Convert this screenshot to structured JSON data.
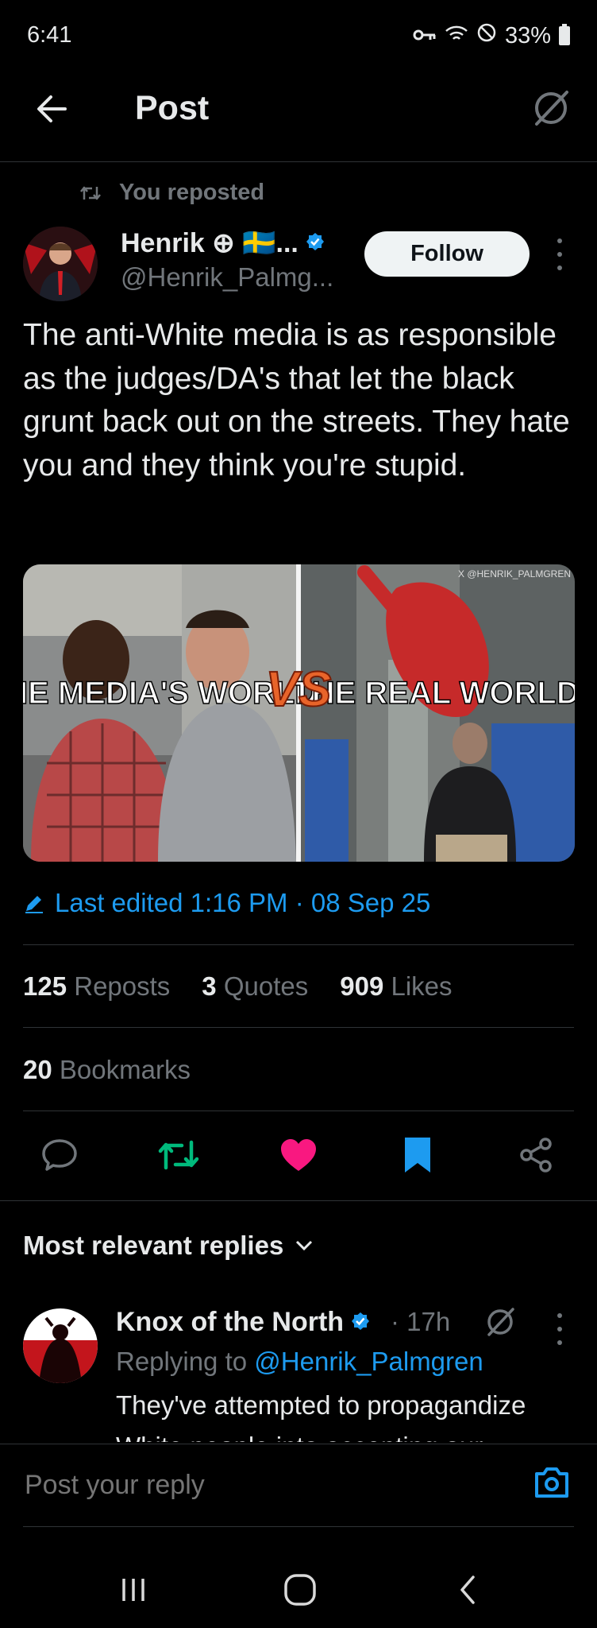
{
  "status": {
    "time": "6:41",
    "battery": "33%"
  },
  "header": {
    "title": "Post"
  },
  "repost": {
    "label": "You reposted"
  },
  "author": {
    "name": "Henrik ⊕ 🇸🇪...",
    "handle": "@Henrik_Palmg..."
  },
  "follow_label": "Follow",
  "tweet": {
    "text": "The anti-White media is as responsible as the judges/DA's that let the black grunt back out on the streets. They hate you and they think you're stupid."
  },
  "media": {
    "left_caption": "THE MEDIA'S WORLD",
    "vs": "VS",
    "right_caption": "THE REAL WORLD",
    "watermark": "X @HENRIK_PALMGREN"
  },
  "edited": {
    "text": "Last edited 1:16 PM · 08 Sep 25"
  },
  "stats": {
    "reposts_count": "125",
    "reposts_label": "Reposts",
    "quotes_count": "3",
    "quotes_label": "Quotes",
    "likes_count": "909",
    "likes_label": "Likes",
    "bookmarks_count": "20",
    "bookmarks_label": "Bookmarks"
  },
  "colors": {
    "accent": "#1d9bf0",
    "repost_active": "#00ba7c",
    "like_active": "#f91880",
    "text": "#e7e9ea",
    "muted": "#71767b"
  },
  "replies": {
    "heading": "Most relevant replies",
    "items": [
      {
        "name": "Knox of the North",
        "time": "· 17h",
        "replying_prefix": "Replying to",
        "replying_handle": "@Henrik_Palmgren",
        "text": "They've attempted to propagandize White people into accepting our"
      }
    ]
  },
  "composer": {
    "placeholder": "Post your reply"
  }
}
